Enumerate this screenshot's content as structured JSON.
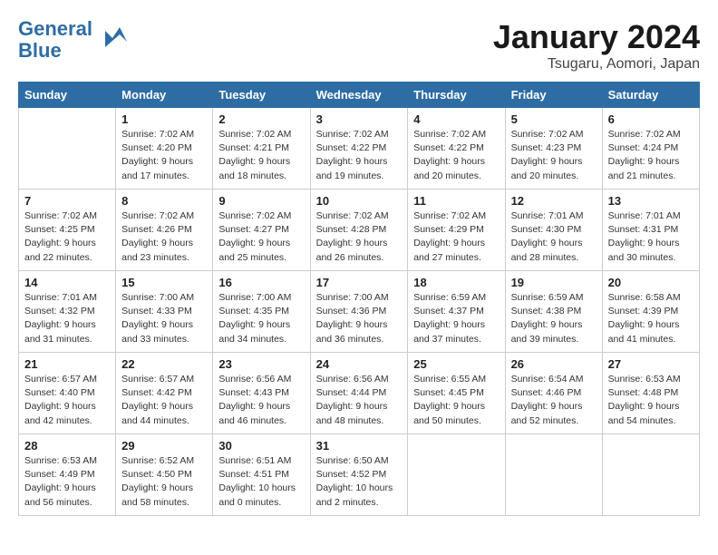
{
  "header": {
    "logo_line1": "General",
    "logo_line2": "Blue",
    "month": "January 2024",
    "location": "Tsugaru, Aomori, Japan"
  },
  "weekdays": [
    "Sunday",
    "Monday",
    "Tuesday",
    "Wednesday",
    "Thursday",
    "Friday",
    "Saturday"
  ],
  "weeks": [
    [
      {
        "day": "",
        "info": ""
      },
      {
        "day": "1",
        "info": "Sunrise: 7:02 AM\nSunset: 4:20 PM\nDaylight: 9 hours\nand 17 minutes."
      },
      {
        "day": "2",
        "info": "Sunrise: 7:02 AM\nSunset: 4:21 PM\nDaylight: 9 hours\nand 18 minutes."
      },
      {
        "day": "3",
        "info": "Sunrise: 7:02 AM\nSunset: 4:22 PM\nDaylight: 9 hours\nand 19 minutes."
      },
      {
        "day": "4",
        "info": "Sunrise: 7:02 AM\nSunset: 4:22 PM\nDaylight: 9 hours\nand 20 minutes."
      },
      {
        "day": "5",
        "info": "Sunrise: 7:02 AM\nSunset: 4:23 PM\nDaylight: 9 hours\nand 20 minutes."
      },
      {
        "day": "6",
        "info": "Sunrise: 7:02 AM\nSunset: 4:24 PM\nDaylight: 9 hours\nand 21 minutes."
      }
    ],
    [
      {
        "day": "7",
        "info": "Sunrise: 7:02 AM\nSunset: 4:25 PM\nDaylight: 9 hours\nand 22 minutes."
      },
      {
        "day": "8",
        "info": "Sunrise: 7:02 AM\nSunset: 4:26 PM\nDaylight: 9 hours\nand 23 minutes."
      },
      {
        "day": "9",
        "info": "Sunrise: 7:02 AM\nSunset: 4:27 PM\nDaylight: 9 hours\nand 25 minutes."
      },
      {
        "day": "10",
        "info": "Sunrise: 7:02 AM\nSunset: 4:28 PM\nDaylight: 9 hours\nand 26 minutes."
      },
      {
        "day": "11",
        "info": "Sunrise: 7:02 AM\nSunset: 4:29 PM\nDaylight: 9 hours\nand 27 minutes."
      },
      {
        "day": "12",
        "info": "Sunrise: 7:01 AM\nSunset: 4:30 PM\nDaylight: 9 hours\nand 28 minutes."
      },
      {
        "day": "13",
        "info": "Sunrise: 7:01 AM\nSunset: 4:31 PM\nDaylight: 9 hours\nand 30 minutes."
      }
    ],
    [
      {
        "day": "14",
        "info": "Sunrise: 7:01 AM\nSunset: 4:32 PM\nDaylight: 9 hours\nand 31 minutes."
      },
      {
        "day": "15",
        "info": "Sunrise: 7:00 AM\nSunset: 4:33 PM\nDaylight: 9 hours\nand 33 minutes."
      },
      {
        "day": "16",
        "info": "Sunrise: 7:00 AM\nSunset: 4:35 PM\nDaylight: 9 hours\nand 34 minutes."
      },
      {
        "day": "17",
        "info": "Sunrise: 7:00 AM\nSunset: 4:36 PM\nDaylight: 9 hours\nand 36 minutes."
      },
      {
        "day": "18",
        "info": "Sunrise: 6:59 AM\nSunset: 4:37 PM\nDaylight: 9 hours\nand 37 minutes."
      },
      {
        "day": "19",
        "info": "Sunrise: 6:59 AM\nSunset: 4:38 PM\nDaylight: 9 hours\nand 39 minutes."
      },
      {
        "day": "20",
        "info": "Sunrise: 6:58 AM\nSunset: 4:39 PM\nDaylight: 9 hours\nand 41 minutes."
      }
    ],
    [
      {
        "day": "21",
        "info": "Sunrise: 6:57 AM\nSunset: 4:40 PM\nDaylight: 9 hours\nand 42 minutes."
      },
      {
        "day": "22",
        "info": "Sunrise: 6:57 AM\nSunset: 4:42 PM\nDaylight: 9 hours\nand 44 minutes."
      },
      {
        "day": "23",
        "info": "Sunrise: 6:56 AM\nSunset: 4:43 PM\nDaylight: 9 hours\nand 46 minutes."
      },
      {
        "day": "24",
        "info": "Sunrise: 6:56 AM\nSunset: 4:44 PM\nDaylight: 9 hours\nand 48 minutes."
      },
      {
        "day": "25",
        "info": "Sunrise: 6:55 AM\nSunset: 4:45 PM\nDaylight: 9 hours\nand 50 minutes."
      },
      {
        "day": "26",
        "info": "Sunrise: 6:54 AM\nSunset: 4:46 PM\nDaylight: 9 hours\nand 52 minutes."
      },
      {
        "day": "27",
        "info": "Sunrise: 6:53 AM\nSunset: 4:48 PM\nDaylight: 9 hours\nand 54 minutes."
      }
    ],
    [
      {
        "day": "28",
        "info": "Sunrise: 6:53 AM\nSunset: 4:49 PM\nDaylight: 9 hours\nand 56 minutes."
      },
      {
        "day": "29",
        "info": "Sunrise: 6:52 AM\nSunset: 4:50 PM\nDaylight: 9 hours\nand 58 minutes."
      },
      {
        "day": "30",
        "info": "Sunrise: 6:51 AM\nSunset: 4:51 PM\nDaylight: 10 hours\nand 0 minutes."
      },
      {
        "day": "31",
        "info": "Sunrise: 6:50 AM\nSunset: 4:52 PM\nDaylight: 10 hours\nand 2 minutes."
      },
      {
        "day": "",
        "info": ""
      },
      {
        "day": "",
        "info": ""
      },
      {
        "day": "",
        "info": ""
      }
    ]
  ]
}
